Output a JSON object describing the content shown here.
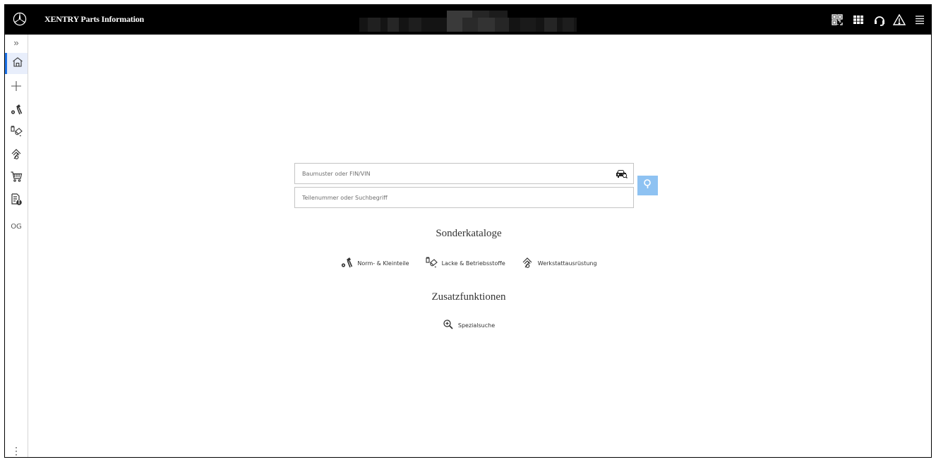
{
  "app": {
    "title": "XENTRY Parts Information"
  },
  "topbar": {
    "icons": [
      "qr-scan-icon",
      "apps-grid-icon",
      "headset-support-icon",
      "warning-icon",
      "menu-icon"
    ]
  },
  "sidebar": {
    "expand_label": "»",
    "items": [
      {
        "name": "home-icon",
        "active": true
      },
      {
        "name": "plus-icon"
      },
      {
        "name": "norm-parts-icon"
      },
      {
        "name": "paint-fluids-icon"
      },
      {
        "name": "workshop-equipment-icon"
      },
      {
        "name": "cart-icon"
      },
      {
        "name": "document-info-icon"
      }
    ],
    "og_label": "OG",
    "more_label": "⋮"
  },
  "search": {
    "vin_placeholder": "Baumuster oder FIN/VIN",
    "part_placeholder": "Teilenummer oder Suchbegriff"
  },
  "sonderkataloge": {
    "title": "Sonderkataloge",
    "items": [
      {
        "label": "Norm- & Kleinteile",
        "icon": "norm-parts-icon"
      },
      {
        "label": "Lacke & Betriebsstoffe",
        "icon": "paint-fluids-icon"
      },
      {
        "label": "Werkstattausrüstung",
        "icon": "workshop-equipment-icon"
      }
    ]
  },
  "zusatzfunktionen": {
    "title": "Zusatzfunktionen",
    "items": [
      {
        "label": "Spezialsuche",
        "icon": "special-search-icon"
      }
    ]
  },
  "colors": {
    "accent": "#1e73e6",
    "search_button": "#8ec2f2",
    "topbar": "#000000"
  }
}
